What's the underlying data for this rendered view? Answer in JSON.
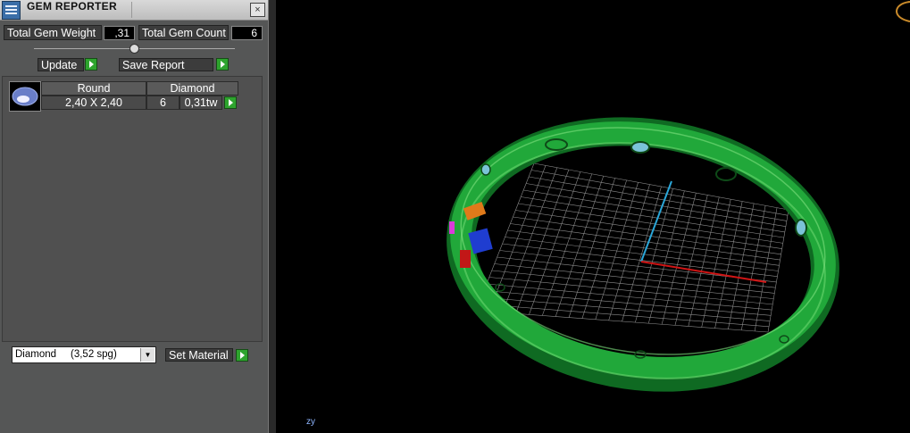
{
  "panel": {
    "title": "GEM REPORTER",
    "close_glyph": "×",
    "total_weight_label": "Total Gem Weight",
    "total_weight_value": ",31",
    "total_count_label": "Total Gem Count",
    "total_count_value": "6",
    "update_label": "Update",
    "save_report_label": "Save Report"
  },
  "gem_table": {
    "headers": [
      "Round",
      "Diamond"
    ],
    "row": {
      "size": "2,40 X 2,40",
      "count": "6",
      "weight": "0,31tw"
    }
  },
  "material": {
    "selected": "Diamond     (3,52 spg)",
    "set_label": "Set Material"
  },
  "viewport": {
    "axis_label": "zy",
    "colors": {
      "model": "#21a83a",
      "grid": "#8d8d8d",
      "axis_x": "#d01515",
      "axis_y": "#2aa6d8"
    }
  },
  "icons": [
    "gem-reporter-app-icon",
    "close-icon",
    "gem-thumbnail-icon",
    "play-arrow-icon",
    "dropdown-arrow-icon"
  ]
}
